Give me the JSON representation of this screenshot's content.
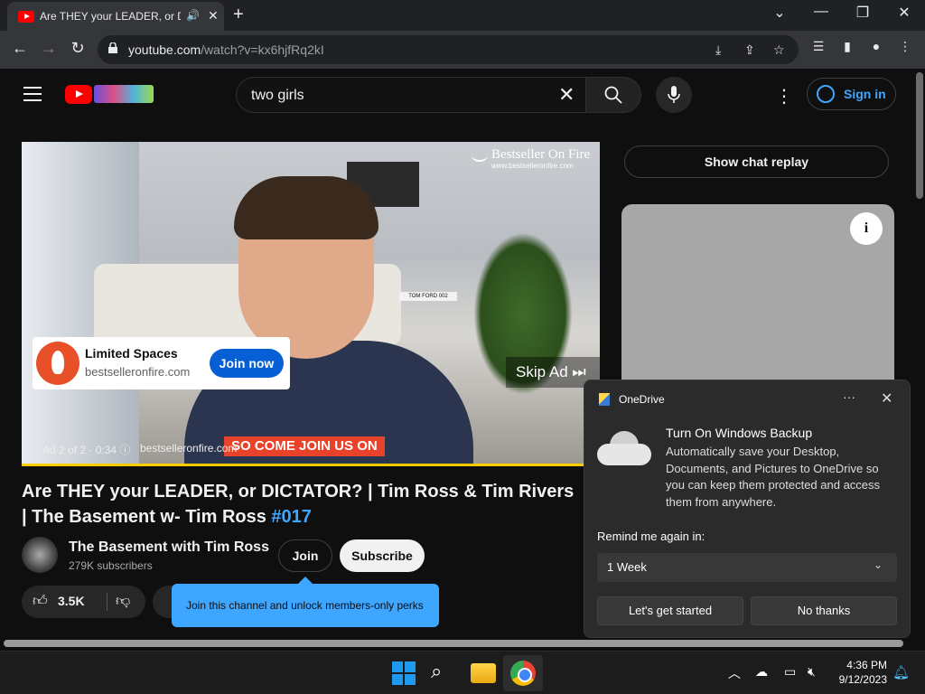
{
  "browser": {
    "tab_title": "Are THEY your LEADER, or DICTATOR? | Tim Ross & Tim Rivers | The Basement w- Tim Ross",
    "url_host": "youtube.com",
    "url_path": "/watch?v=kx6hjfRq2kI"
  },
  "youtube": {
    "search_value": "two girls",
    "sign_in": "Sign in"
  },
  "video": {
    "brand_name": "Bestseller On Fire",
    "brand_url": "www.bestselleronfire.com",
    "tom_ford": "TOM FORD 002",
    "ad_card": {
      "title": "Limited Spaces",
      "site": "bestselleronfire.com",
      "cta": "Join now"
    },
    "skip_ad": "Skip Ad",
    "ad_info": "Ad 2 of 2 · 0:34",
    "ad_url": "bestselleronfire.com",
    "banner": "SO COME JOIN US ON",
    "progress": 1.0
  },
  "meta": {
    "title": "Are THEY your LEADER, or DICTATOR? | Tim Ross & Tim Rivers | The Basement w- Tim Ross",
    "hashtag": "#017",
    "channel_name": "The Basement with Tim Ross",
    "subscribers": "279K subscribers",
    "join": "Join",
    "subscribe": "Subscribe",
    "likes": "3.5K",
    "tooltip": "Join this channel and unlock members-only perks"
  },
  "sidebar": {
    "chat_replay": "Show chat replay"
  },
  "onedrive": {
    "app": "OneDrive",
    "more": "···",
    "heading": "Turn On Windows Backup",
    "body": "Automatically save your Desktop, Documents, and Pictures to OneDrive so you can keep them protected and access them from anywhere.",
    "remind_label": "Remind me again in:",
    "remind_value": "1 Week",
    "primary": "Let's get started",
    "secondary": "No thanks"
  },
  "taskbar": {
    "time": "4:36 PM",
    "date": "9/12/2023"
  },
  "colors": {
    "accent": "#3ea6ff",
    "yt_red": "#ff0000",
    "join_now": "#065fd4"
  },
  "icons": [
    "youtube-favicon",
    "speaker-icon",
    "close-icon",
    "plus-icon",
    "back-icon",
    "forward-icon",
    "reload-icon",
    "lock-icon",
    "download-icon",
    "share-icon",
    "star-icon",
    "reading-list-icon",
    "sidepanel-icon",
    "profile-icon",
    "kebab-icon",
    "hamburger-icon",
    "search-icon",
    "mic-icon",
    "user-circle-icon",
    "info-icon",
    "thumbs-up-icon",
    "thumbs-down-icon",
    "onedrive-icon",
    "cloud-icon",
    "chevron-down-icon",
    "windows-start-icon",
    "folder-icon",
    "chrome-icon",
    "bell-icon"
  ]
}
